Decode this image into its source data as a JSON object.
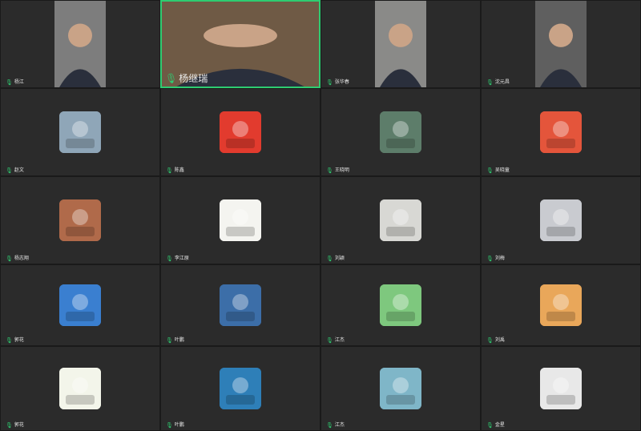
{
  "participants": [
    {
      "name": "杨江",
      "type": "video",
      "bg": "#7d7d7d"
    },
    {
      "name": "杨继瑞",
      "type": "video",
      "bg": "#6f5a45",
      "active": true
    },
    {
      "name": "张华春",
      "type": "video",
      "bg": "#8a8a88"
    },
    {
      "name": "沈元昌",
      "type": "video",
      "bg": "#5f5f5f"
    },
    {
      "name": "赵文",
      "type": "avatar",
      "icon": "statue-photo-icon",
      "bg": "#8fa6b8"
    },
    {
      "name": "陈鑫",
      "type": "avatar",
      "icon": "cartoon-boy-icon",
      "bg": "#e23b2e"
    },
    {
      "name": "王晓明",
      "type": "avatar",
      "icon": "river-town-photo-icon",
      "bg": "#5d7d6a"
    },
    {
      "name": "吴晓童",
      "type": "avatar",
      "icon": "cartoon-child-icon",
      "bg": "#e4553b"
    },
    {
      "name": "杨志翔",
      "type": "avatar",
      "icon": "planet-landscape-icon",
      "bg": "#b06a4a"
    },
    {
      "name": "李江原",
      "type": "avatar",
      "icon": "child-drawing-icon",
      "bg": "#f4f4f0"
    },
    {
      "name": "刘颖",
      "type": "avatar",
      "icon": "building-photo-icon",
      "bg": "#d8d8d4"
    },
    {
      "name": "刘梅",
      "type": "avatar",
      "icon": "dog-snow-photo-icon",
      "bg": "#c9cbd0"
    },
    {
      "name": "郭花",
      "type": "avatar",
      "icon": "flower-field-photo-icon",
      "bg": "#3a7fd0"
    },
    {
      "name": "叶鹏",
      "type": "avatar",
      "icon": "mountain-view-photo-icon",
      "bg": "#3c6ea8"
    },
    {
      "name": "江杰",
      "type": "avatar",
      "icon": "cartoon-man-icon",
      "bg": "#7ec87e"
    },
    {
      "name": "刘禹",
      "type": "avatar",
      "icon": "shiba-dog-photo-icon",
      "bg": "#e9a75a"
    },
    {
      "name": "郭花",
      "type": "avatar",
      "icon": "cartoon-cat-icon",
      "bg": "#f3f5ea"
    },
    {
      "name": "叶鹏",
      "type": "avatar",
      "icon": "panda-mountain-icon",
      "bg": "#2e7fb8"
    },
    {
      "name": "江杰",
      "type": "avatar",
      "icon": "beach-photo-icon",
      "bg": "#7fb6c8"
    },
    {
      "name": "金星",
      "type": "avatar",
      "icon": "rainbow-hands-icon",
      "bg": "#e8e8e8"
    }
  ],
  "colors": {
    "accent": "#2ecc71",
    "tile": "#2b2b2b",
    "background": "#1c1c1c"
  }
}
